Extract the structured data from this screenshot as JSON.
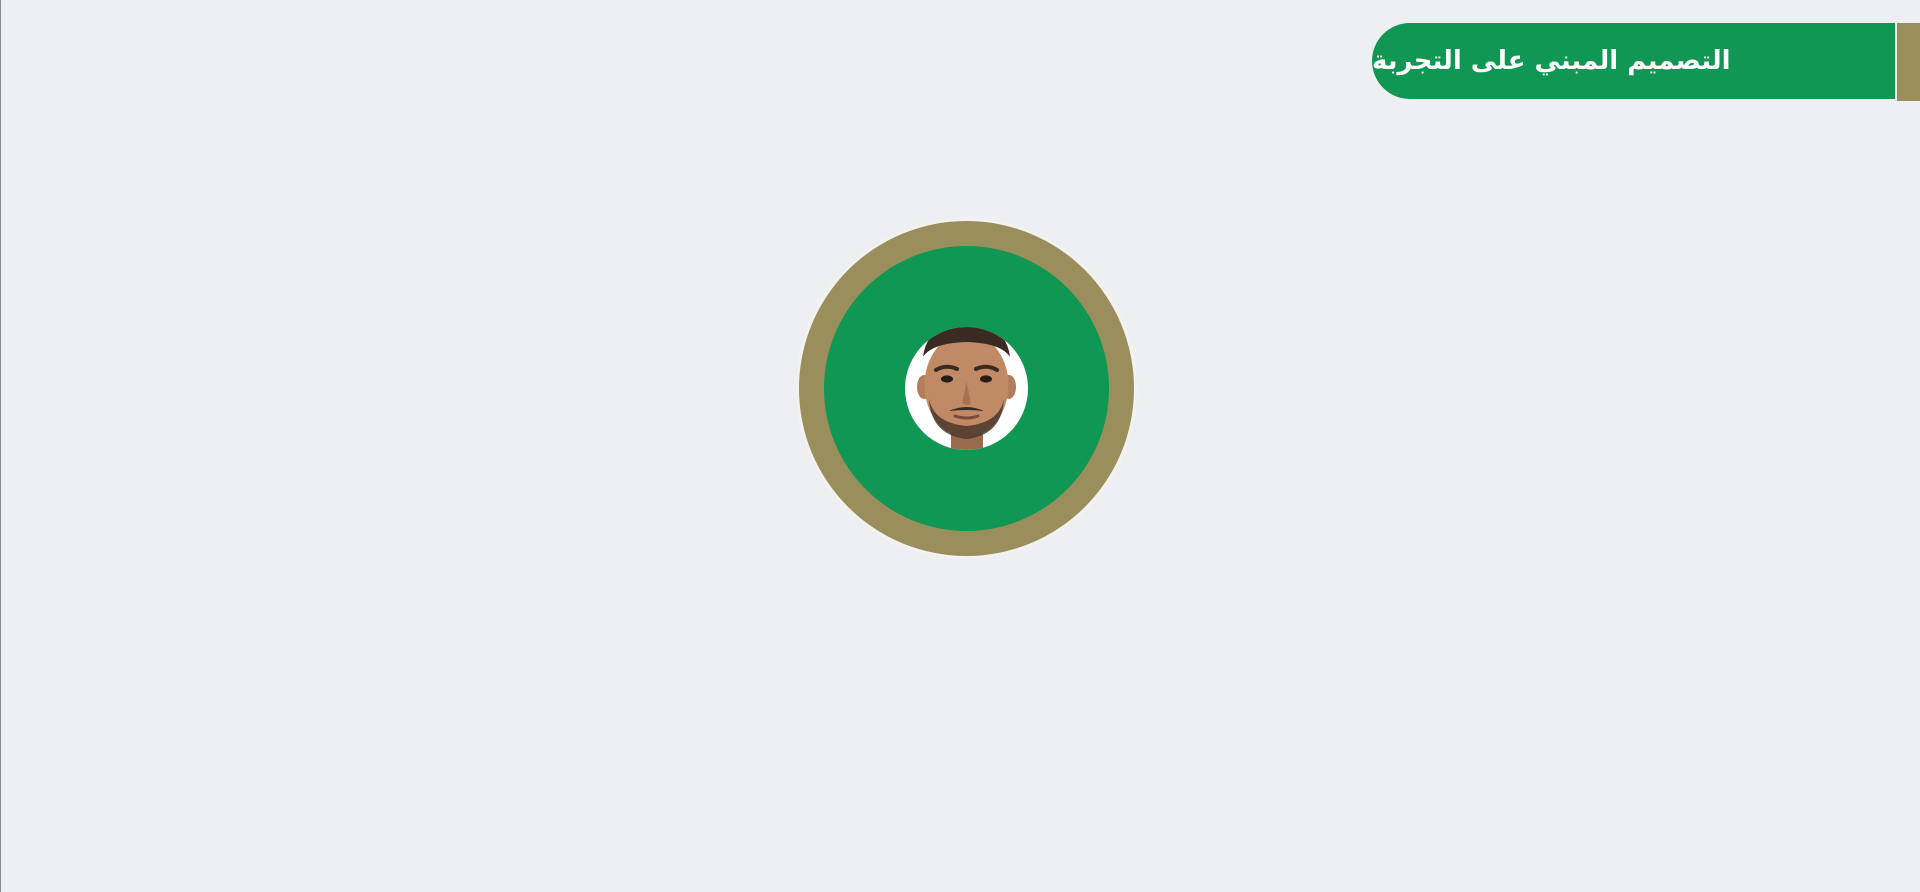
{
  "header": {
    "title": "التصميم المبني على التجربة"
  },
  "colors": {
    "background": "#edeff2",
    "brand_green": "#0f9753",
    "brand_gold": "#9a8f5c",
    "title_text": "#ffffff"
  },
  "presenter": {
    "icon": "presenter-avatar"
  }
}
